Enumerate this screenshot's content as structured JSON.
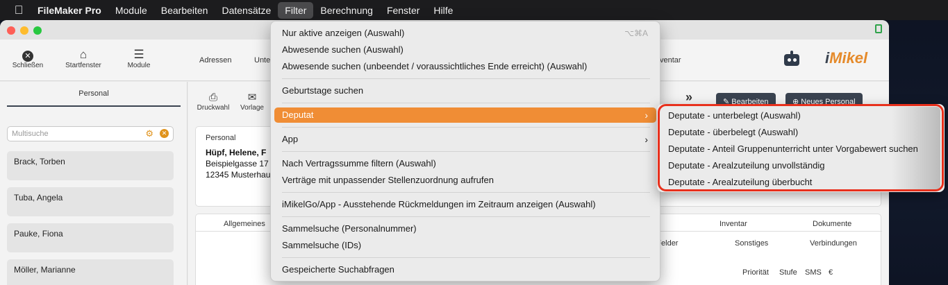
{
  "menubar": {
    "apple_icon": "apple-icon",
    "items": [
      "FileMaker Pro",
      "Module",
      "Bearbeiten",
      "Datensätze",
      "Filter",
      "Berechnung",
      "Fenster",
      "Hilfe"
    ],
    "active": "Filter"
  },
  "window": {
    "title": "",
    "toolbar": {
      "buttons": [
        {
          "label": "Schließen",
          "icon": "close-circle-icon"
        },
        {
          "label": "Startfenster",
          "icon": "home-icon"
        },
        {
          "label": "Module",
          "icon": "menu-icon"
        }
      ],
      "tabs": [
        "Adressen",
        "Unte",
        "ventar"
      ],
      "logo": "iMikel"
    },
    "sidebar": {
      "title": "Personal",
      "search_placeholder": "Multisuche",
      "persons": [
        "Brack, Torben",
        "Tuba, Angela",
        "Pauke, Fiona",
        "Möller, Marianne"
      ]
    },
    "main": {
      "actions": [
        {
          "label": "Druckwahl",
          "icon": "print-icon"
        },
        {
          "label": "Vorlage",
          "icon": "mail-icon"
        }
      ],
      "edit_button": "Bearbeiten",
      "new_button": "Neues Personal",
      "card": {
        "label": "Personal",
        "name": "Hüpf, Helene, F",
        "street": "Beispielgasse 17",
        "city": "12345 Musterhau"
      },
      "tabs": [
        "Allgemeines",
        "Inventar",
        "Dokumente"
      ],
      "subtabs": [
        "ne Felder",
        "Sonstiges",
        "Verbindungen"
      ],
      "columns": [
        "Priorität",
        "Stufe",
        "SMS",
        "€"
      ]
    }
  },
  "filter_menu": {
    "items": [
      {
        "label": "Nur aktive anzeigen (Auswahl)",
        "shortcut": "⌥⌘A"
      },
      {
        "label": "Abwesende suchen (Auswahl)"
      },
      {
        "label": "Abwesende suchen (unbeendet / voraussichtliches Ende erreicht) (Auswahl)"
      },
      {
        "label": "Geburtstage suchen"
      },
      {
        "label": "Deputat",
        "submenu": true,
        "highlighted": true
      },
      {
        "label": "App",
        "submenu": true
      },
      {
        "label": "Nach Vertragssumme filtern (Auswahl)"
      },
      {
        "label": "Verträge mit unpassender Stellenzuordnung aufrufen"
      },
      {
        "label": "iMikelGo/App - Ausstehende Rückmeldungen im Zeitraum anzeigen (Auswahl)"
      },
      {
        "label": "Sammelsuche (Personalnummer)"
      },
      {
        "label": "Sammelsuche (IDs)"
      },
      {
        "label": "Gespeicherte Suchabfragen"
      }
    ],
    "highlight_color": "#f08d35"
  },
  "deputat_submenu": {
    "items": [
      "Deputate - unterbelegt (Auswahl)",
      "Deputate - überbelegt (Auswahl)",
      "Deputate - Anteil Gruppenunterricht unter Vorgabewert suchen",
      "Deputate - Arealzuteilung unvollständig",
      "Deputate - Arealzuteilung überbucht"
    ],
    "outline_color": "#e8301c"
  }
}
